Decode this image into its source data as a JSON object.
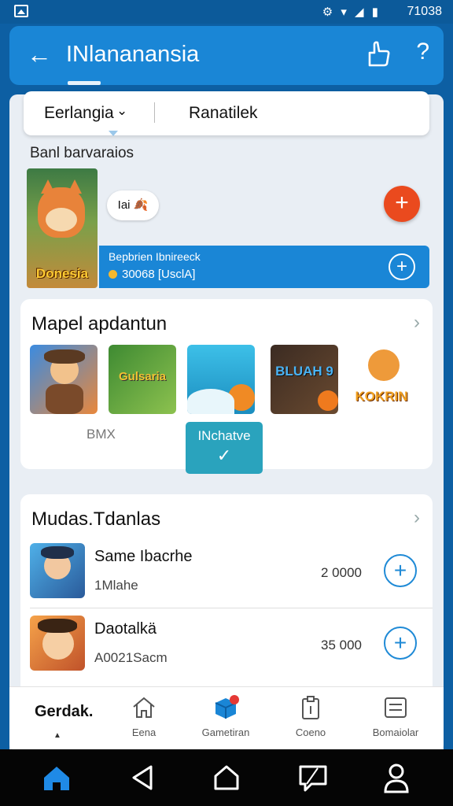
{
  "status": {
    "icons": "⚙ ▾ ◢ ▮",
    "time": "71038"
  },
  "header": {
    "back": "←",
    "title": "INlananansia",
    "help": "?"
  },
  "tabs": {
    "first": "Eerlangia",
    "chevron": "⌄",
    "second": "Ranatilek"
  },
  "section": {
    "label": "Banl barvaraios"
  },
  "banner": {
    "poster_title": "Donesia",
    "pill_text": "Iai 🍂",
    "fab": "+",
    "line1": "Bepbrien Ibnireeck",
    "line2": "30068 [UsclA]",
    "plus": "+"
  },
  "card1": {
    "title": "Mapel apdantun",
    "chevron": "›",
    "thumbs": [
      "",
      "Gulsaria",
      "",
      "BLUAH 9",
      "KOKRIN"
    ],
    "caption": "BMX",
    "featured_label": "INchatve",
    "featured_check": "✓"
  },
  "card2": {
    "title": "Mudas.Tdanlas",
    "chevron": "›",
    "rows": [
      {
        "name": "Same Ibacrhe",
        "sub": "1Mlahe",
        "price": "2 0000",
        "plus": "+"
      },
      {
        "name": "Daotalkä",
        "sub": "A0021Sacm",
        "price": "35 000",
        "plus": "+"
      }
    ]
  },
  "tabbar": {
    "first": "Gerdak.",
    "items": [
      "Eena",
      "Gametiran",
      "Coeno",
      "Bomaiolar"
    ]
  },
  "colors": {
    "accent": "#1a86d6",
    "fab": "#ea4a1e",
    "featured": "#2aa3bd"
  }
}
